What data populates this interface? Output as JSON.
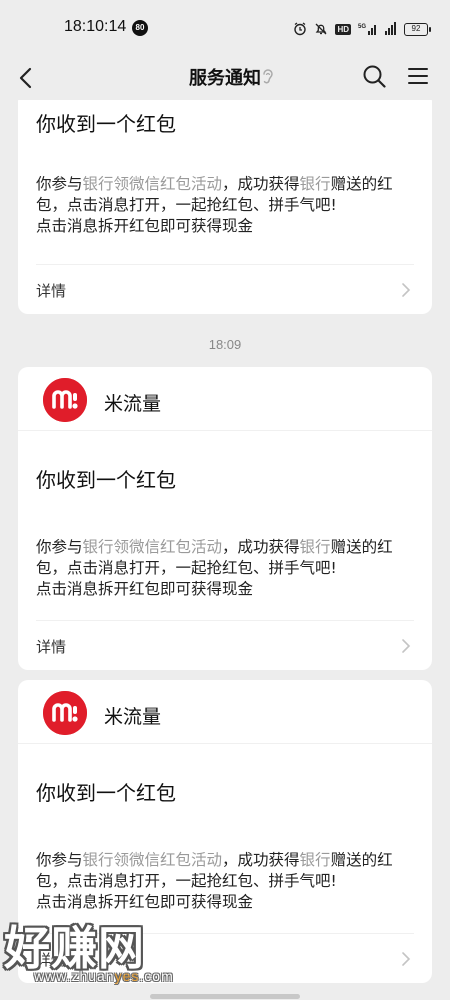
{
  "status_bar": {
    "time": "18:10:14",
    "badge": "80",
    "hd_label": "HD",
    "network_label": "5G",
    "battery": "92"
  },
  "nav": {
    "title": "服务通知"
  },
  "timestamp": "18:09",
  "message": {
    "app_name": "米流量",
    "title": "你收到一个红包",
    "body_1_prefix": "你参与",
    "body_1_link1": "银行领微信红包活动",
    "body_1_mid": "，成功获得",
    "body_1_link2": "银行",
    "body_1_suffix": "赠送的红",
    "body_2": "包，点击消息打开，一起抢红包、拼手气吧!",
    "body_3": "点击消息拆开红包即可获得现金",
    "detail_label": "详情"
  },
  "watermark": {
    "main": "好赚网",
    "url_prefix": "www.zhuan",
    "url_highlight": "yes",
    "url_suffix": ".com"
  },
  "colors": {
    "background": "#ededed",
    "card": "#ffffff",
    "brand_red": "#e01d2a",
    "muted_text": "#9a9a9a"
  }
}
